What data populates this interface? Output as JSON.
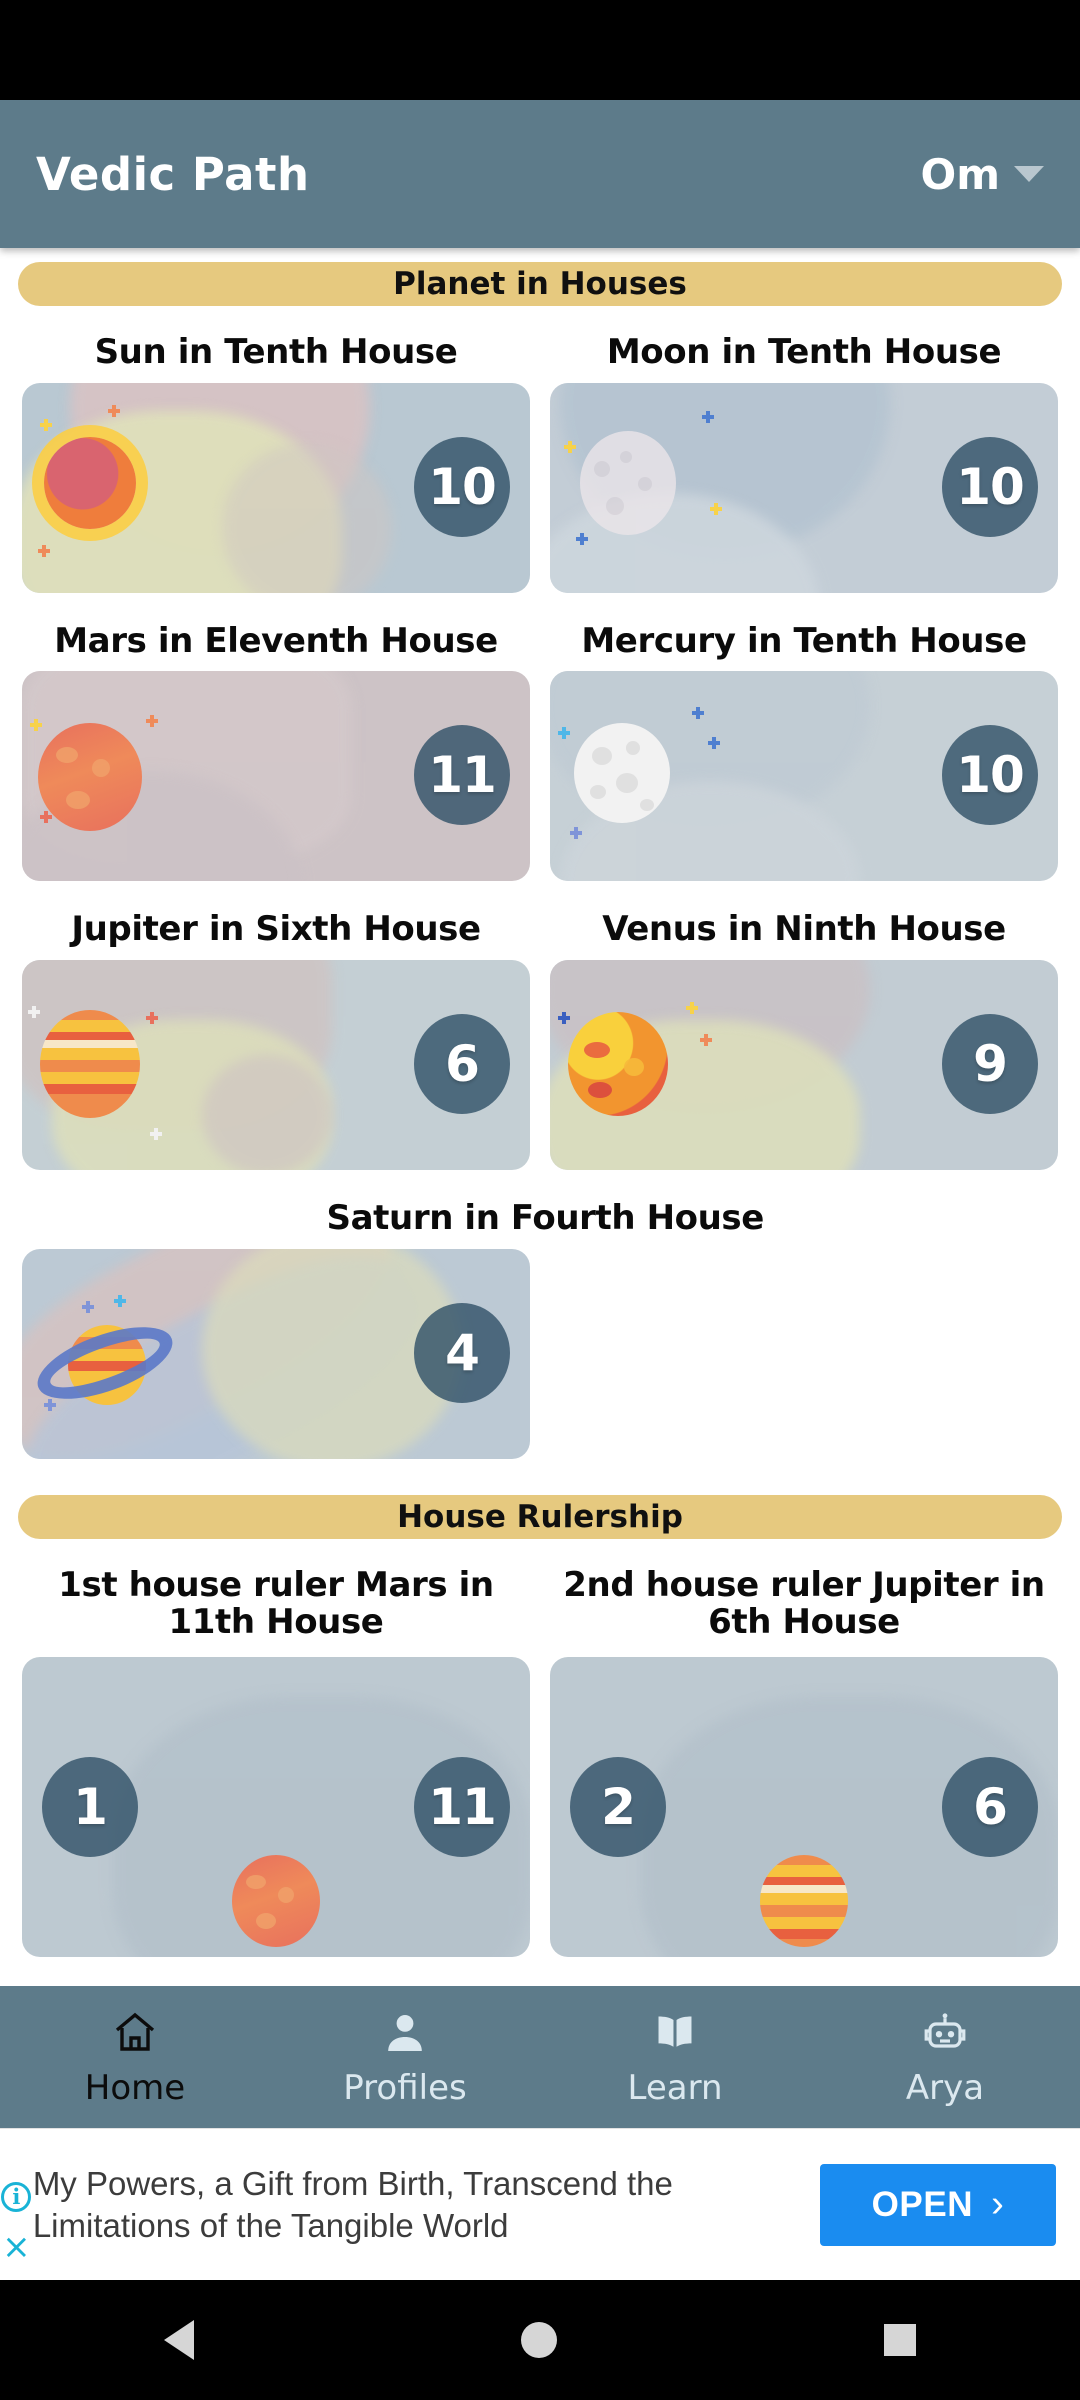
{
  "app": {
    "title": "Vedic Path",
    "mantra_label": "Om",
    "dropdown_icon": "chevron-down-icon"
  },
  "sections": [
    {
      "id": "planet-in-houses",
      "title": "Planet in Houses"
    },
    {
      "id": "house-rulership",
      "title": "House Rulership"
    }
  ],
  "planet_cards": [
    {
      "title": "Sun in Tenth House",
      "planet": "sun",
      "house": "10"
    },
    {
      "title": "Moon in Tenth House",
      "planet": "moon",
      "house": "10"
    },
    {
      "title": "Mars in Eleventh House",
      "planet": "mars",
      "house": "11"
    },
    {
      "title": "Mercury in Tenth House",
      "planet": "mercury",
      "house": "10"
    },
    {
      "title": "Jupiter in Sixth House",
      "planet": "jupiter",
      "house": "6"
    },
    {
      "title": "Venus in Ninth House",
      "planet": "venus",
      "house": "9"
    },
    {
      "title": "Saturn in Fourth House",
      "planet": "saturn",
      "house": "4"
    }
  ],
  "rulership_cards": [
    {
      "title": "1st house ruler Mars in 11th House",
      "planet": "mars",
      "house_from": "1",
      "house_to": "11"
    },
    {
      "title": "2nd house ruler Jupiter in 6th House",
      "planet": "jupiter",
      "house_from": "2",
      "house_to": "6"
    }
  ],
  "bottom_nav": {
    "items": [
      {
        "label": "Home",
        "icon": "home-icon",
        "active": true
      },
      {
        "label": "Profiles",
        "icon": "person-icon",
        "active": false
      },
      {
        "label": "Learn",
        "icon": "book-icon",
        "active": false
      },
      {
        "label": "Arya",
        "icon": "robot-icon",
        "active": false
      }
    ]
  },
  "ad": {
    "text": "My Powers, a Gift from Birth, Transcend the Limitations of the Tangible World",
    "cta_label": "OPEN",
    "cta_chevron": "chevron-right-icon",
    "info_glyph": "i",
    "close_glyph": "×"
  },
  "system_nav": {
    "back": "back-triangle-icon",
    "home": "home-circle-icon",
    "recents": "recents-square-icon"
  },
  "colors": {
    "app_bar": "#5d7b8a",
    "section_pill": "#e6c97f",
    "badge": "#2f5066",
    "ad_cta": "#1a8cf0",
    "ad_accent": "#19b3d6"
  }
}
